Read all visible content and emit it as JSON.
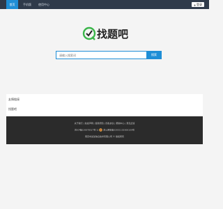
{
  "nav": {
    "items": [
      {
        "label": "首页",
        "active": true
      },
      {
        "label": "手机版",
        "active": false
      },
      {
        "label": "使用中心",
        "active": false
      }
    ],
    "login_label": "登录"
  },
  "logo": {
    "text": "找题吧",
    "brand_color": "#3bb54a"
  },
  "search": {
    "placeholder": "请输入搜索词",
    "button_label": "搜索"
  },
  "sections": [
    {
      "label": "友情链接"
    },
    {
      "label": "找题吧"
    }
  ],
  "footer": {
    "links": [
      "关于我们",
      "免责声明",
      "使用须知",
      "隐私协议",
      "帮助中心",
      "意见反馈"
    ],
    "line2": "苏ICP备1000785(7号-1)",
    "line2b": "苏公网安备32051102000109号",
    "line3": "南京市某某信息技术有限公司 © 版权所有"
  },
  "colors": {
    "accent": "#1f8ed6",
    "topbar": "#2f3a4a",
    "footer": "#2b2b2b"
  }
}
